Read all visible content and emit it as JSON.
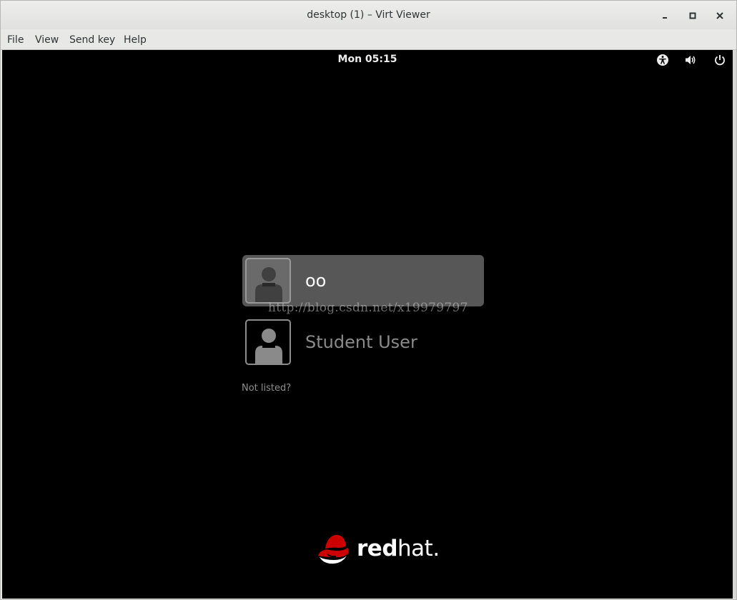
{
  "window": {
    "title": "desktop (1) – Virt Viewer",
    "controls": [
      "minimize-icon",
      "maximize-icon",
      "close-icon"
    ]
  },
  "menu": {
    "items": [
      {
        "label": "File"
      },
      {
        "label": "View"
      },
      {
        "label": "Send key"
      },
      {
        "label": "Help"
      }
    ]
  },
  "guest": {
    "clock": "Mon 05:15",
    "status_icons": [
      "accessibility-icon",
      "volume-icon",
      "power-icon"
    ],
    "users": [
      {
        "name": "oo",
        "selected": true
      },
      {
        "name": "Student User",
        "selected": false
      }
    ],
    "not_listed": "Not listed?",
    "watermark": "http://blog.csdn.net/x19979797",
    "brand": {
      "bold": "red",
      "regular": "hat",
      "mark": ".",
      "accent": "#cc0000"
    }
  }
}
